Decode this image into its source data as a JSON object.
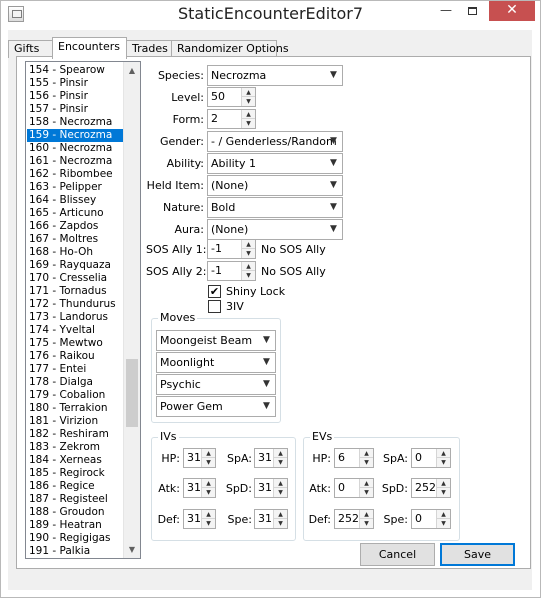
{
  "window": {
    "title": "StaticEncounterEditor7"
  },
  "tabs": [
    {
      "label": "Gifts",
      "active": false
    },
    {
      "label": "Encounters",
      "active": true
    },
    {
      "label": "Trades",
      "active": false
    },
    {
      "label": "Randomizer Options",
      "active": false
    }
  ],
  "encounter_list": {
    "items": [
      "154 - Spearow",
      "155 - Pinsir",
      "156 - Pinsir",
      "157 - Pinsir",
      "158 - Necrozma",
      "159 - Necrozma",
      "160 - Necrozma",
      "161 - Necrozma",
      "162 - Ribombee",
      "163 - Pelipper",
      "164 - Blissey",
      "165 - Articuno",
      "166 - Zapdos",
      "167 - Moltres",
      "168 - Ho-Oh",
      "169 - Rayquaza",
      "170 - Cresselia",
      "171 - Tornadus",
      "172 - Thundurus",
      "173 - Landorus",
      "174 - Yveltal",
      "175 - Mewtwo",
      "176 - Raikou",
      "177 - Entei",
      "178 - Dialga",
      "179 - Cobalion",
      "180 - Terrakion",
      "181 - Virizion",
      "182 - Reshiram",
      "183 - Zekrom",
      "184 - Xerneas",
      "185 - Regirock",
      "186 - Regice",
      "187 - Registeel",
      "188 - Groudon",
      "189 - Heatran",
      "190 - Regigigas",
      "191 - Palkia"
    ],
    "selected": "159 - Necrozma"
  },
  "form": {
    "species": {
      "label": "Species:",
      "value": "Necrozma"
    },
    "level": {
      "label": "Level:",
      "value": "50"
    },
    "form": {
      "label": "Form:",
      "value": "2"
    },
    "gender": {
      "label": "Gender:",
      "value": "- / Genderless/Random"
    },
    "ability": {
      "label": "Ability:",
      "value": "Ability 1"
    },
    "held_item": {
      "label": "Held Item:",
      "value": "(None)"
    },
    "nature": {
      "label": "Nature:",
      "value": "Bold"
    },
    "aura": {
      "label": "Aura:",
      "value": "(None)"
    },
    "sos_ally_1": {
      "label": "SOS Ally 1:",
      "value": "-1",
      "status": "No SOS Ally"
    },
    "sos_ally_2": {
      "label": "SOS Ally 2:",
      "value": "-1",
      "status": "No SOS Ally"
    },
    "shiny_lock": {
      "label": "Shiny Lock",
      "checked": true,
      "mark": "✔"
    },
    "three_iv": {
      "label": "3IV",
      "checked": false
    }
  },
  "moves": {
    "title": "Moves",
    "items": [
      "Moongeist Beam",
      "Moonlight",
      "Psychic",
      "Power Gem"
    ]
  },
  "ivs": {
    "title": "IVs",
    "hp": {
      "label": "HP:",
      "value": "31"
    },
    "atk": {
      "label": "Atk:",
      "value": "31"
    },
    "def": {
      "label": "Def:",
      "value": "31"
    },
    "spa": {
      "label": "SpA:",
      "value": "31"
    },
    "spd": {
      "label": "SpD:",
      "value": "31"
    },
    "spe": {
      "label": "Spe:",
      "value": "31"
    }
  },
  "evs": {
    "title": "EVs",
    "hp": {
      "label": "HP:",
      "value": "6"
    },
    "atk": {
      "label": "Atk:",
      "value": "0"
    },
    "def": {
      "label": "Def:",
      "value": "252"
    },
    "spa": {
      "label": "SpA:",
      "value": "0"
    },
    "spd": {
      "label": "SpD:",
      "value": "252"
    },
    "spe": {
      "label": "Spe:",
      "value": "0"
    }
  },
  "buttons": {
    "cancel": "Cancel",
    "save": "Save"
  },
  "icons": {
    "dropdown": "▼",
    "spin_up": "▲",
    "spin_down": "▼",
    "scroll_up": "▲",
    "scroll_down": "▼",
    "minimize": "—",
    "close": "✕"
  },
  "colors": {
    "selection": "#0078d7",
    "close_button": "#c75050"
  }
}
